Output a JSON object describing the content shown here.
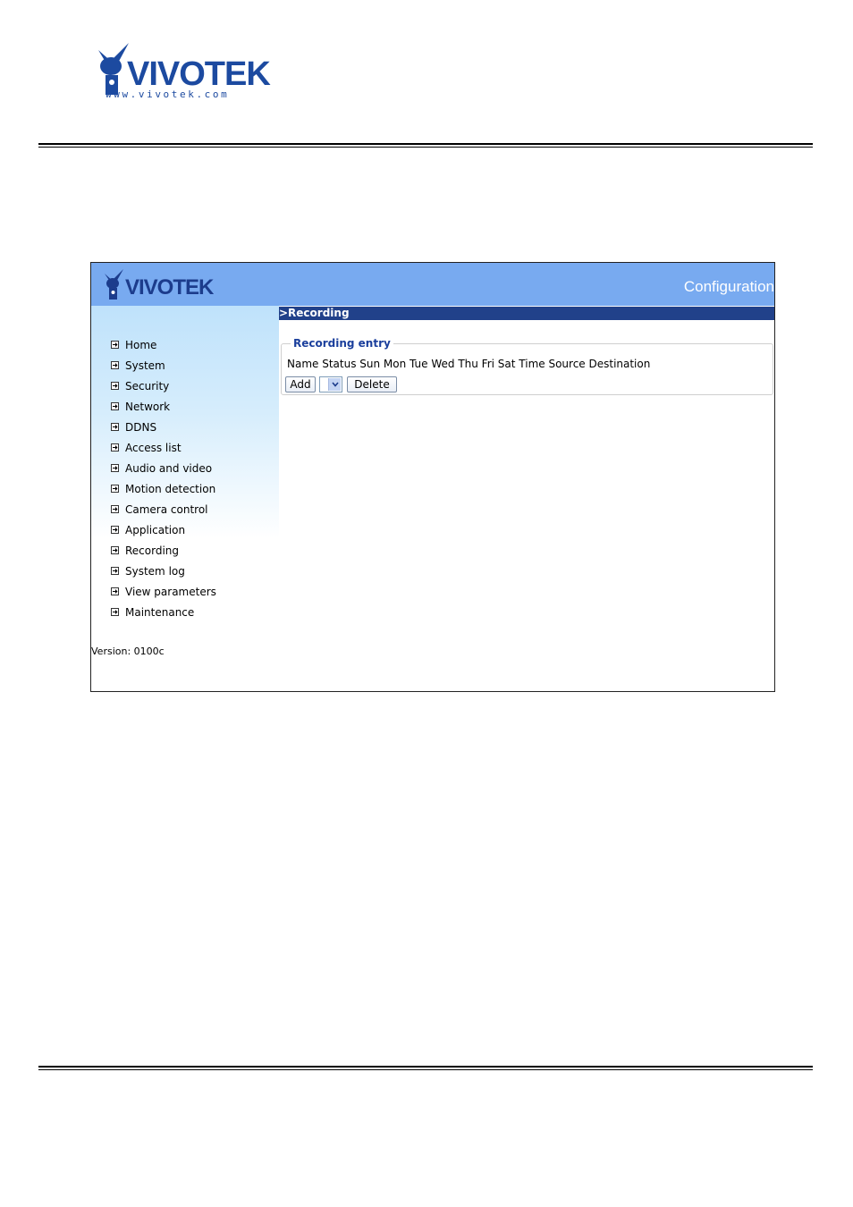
{
  "document": {
    "logo_text": "VIVOTEK",
    "logo_url": "www.vivotek.com"
  },
  "app": {
    "logo_text": "VIVOTEK",
    "header_title": "Configuration",
    "page_title": ">Recording",
    "version": "Version: 0100c"
  },
  "sidebar": {
    "items": [
      {
        "label": "Home"
      },
      {
        "label": "System"
      },
      {
        "label": "Security"
      },
      {
        "label": "Network"
      },
      {
        "label": "DDNS"
      },
      {
        "label": "Access list"
      },
      {
        "label": "Audio and video"
      },
      {
        "label": "Motion detection"
      },
      {
        "label": "Camera control"
      },
      {
        "label": "Application"
      },
      {
        "label": "Recording"
      },
      {
        "label": "System log"
      },
      {
        "label": "View parameters"
      },
      {
        "label": "Maintenance"
      }
    ],
    "icon": "arrow-right-icon"
  },
  "recording_entry": {
    "legend": "Recording entry",
    "columns": "Name Status Sun Mon Tue Wed Thu Fri Sat Time Source Destination",
    "add_label": "Add",
    "delete_label": "Delete",
    "selected_value": ""
  },
  "colors": {
    "header_bar": "#78aaf0",
    "title_bar": "#21418a",
    "brand_blue": "#1c4aa0"
  }
}
